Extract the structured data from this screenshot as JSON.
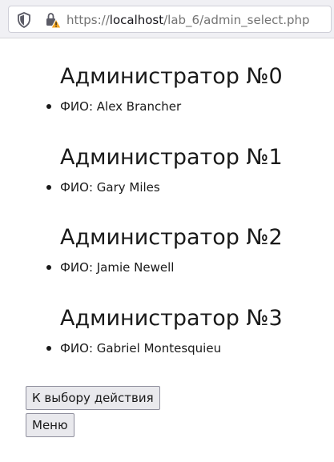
{
  "browser": {
    "url_prefix": "https://",
    "url_host": "localhost",
    "url_path": "/lab_6/admin_select.php"
  },
  "admins": [
    {
      "title": "Администратор №0",
      "fio": "ФИО: Alex Brancher"
    },
    {
      "title": "Администратор №1",
      "fio": "ФИО: Gary Miles"
    },
    {
      "title": "Администратор №2",
      "fio": "ФИО: Jamie Newell"
    },
    {
      "title": "Администратор №3",
      "fio": "ФИО: Gabriel Montesquieu"
    }
  ],
  "buttons": {
    "back_label": "К выбору действия",
    "menu_label": "Меню"
  },
  "colors": {
    "lock_warning": "#f5a623"
  },
  "icons": {
    "shield": "shield-icon",
    "lock": "lock-warning-icon"
  }
}
